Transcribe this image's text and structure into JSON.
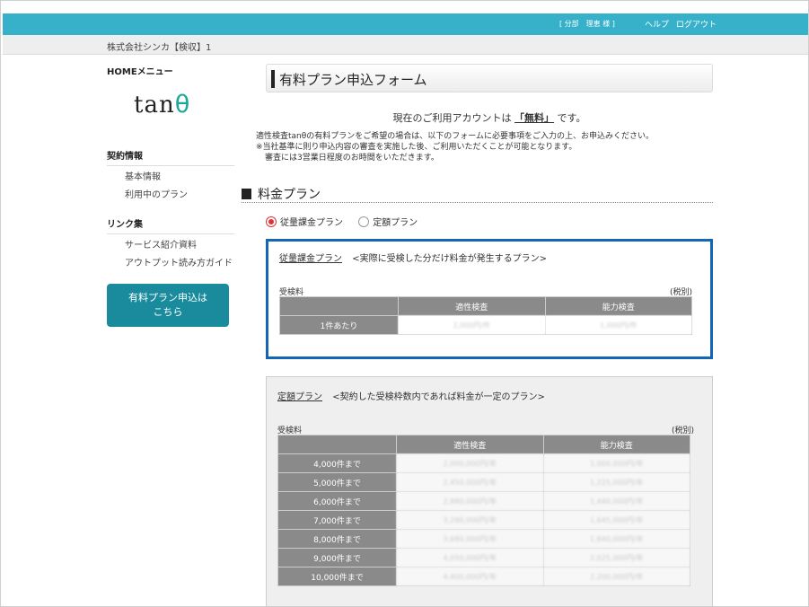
{
  "header": {
    "user_info": "[ 分部　理恵 様 ]",
    "help_label": "ヘルプ",
    "logout_label": "ログアウト",
    "company": "株式会社シンカ【検収】1"
  },
  "sidebar": {
    "home_title": "HOMEメニュー",
    "logo_text": "tan",
    "logo_symbol": "θ",
    "contract_title": "契約情報",
    "contract_items": [
      "基本情報",
      "利用中のプラン"
    ],
    "links_title": "リンク集",
    "link_items": [
      "サービス紹介資料",
      "アウトプット読み方ガイド"
    ],
    "apply_button": [
      "有料プラン申込は",
      "こちら"
    ]
  },
  "main": {
    "form_title": "有料プラン申込フォーム",
    "account_prefix": "現在のご利用アカウントは",
    "account_plan": "「無料」",
    "account_suffix": "です。",
    "desc_lines": [
      "適性検査tanθの有料プランをご希望の場合は、以下のフォームに必要事項をご入力の上、お申込みください。",
      "※当社基準に則り申込内容の審査を実施した後、ご利用いただくことが可能となります。",
      "審査には3営業日程度のお時間をいただきます。"
    ],
    "price_heading": "料金プラン",
    "radio_options": [
      {
        "label": "従量課金プラン",
        "selected": true
      },
      {
        "label": "定額プラン",
        "selected": false
      }
    ],
    "usage_plan": {
      "name": "従量課金プラン",
      "description": "<実際に受検した分だけ料金が発生するプラン>",
      "fee_label": "受検料",
      "tax_label": "(税別)",
      "columns": [
        "適性検査",
        "能力検査"
      ],
      "rows": [
        {
          "label": "1件あたり",
          "values": [
            "2,000円/件",
            "1,000円/件"
          ]
        }
      ]
    },
    "fixed_plan": {
      "name": "定額プラン",
      "description": "<契約した受検枠数内であれば料金が一定のプラン>",
      "fee_label": "受検料",
      "tax_label": "(税別)",
      "columns": [
        "適性検査",
        "能力検査"
      ],
      "rows": [
        {
          "label": "4,000件まで",
          "values": [
            "2,000,000円/年",
            "1,000,000円/年"
          ]
        },
        {
          "label": "5,000件まで",
          "values": [
            "2,450,000円/年",
            "1,225,000円/年"
          ]
        },
        {
          "label": "6,000件まで",
          "values": [
            "2,880,000円/年",
            "1,440,000円/年"
          ]
        },
        {
          "label": "7,000件まで",
          "values": [
            "3,290,000円/年",
            "1,645,000円/年"
          ]
        },
        {
          "label": "8,000件まで",
          "values": [
            "3,680,000円/年",
            "1,840,000円/年"
          ]
        },
        {
          "label": "9,000件まで",
          "values": [
            "4,050,000円/年",
            "2,025,000円/年"
          ]
        },
        {
          "label": "10,000件まで",
          "values": [
            "4,400,000円/年",
            "2,200,000円/年"
          ]
        }
      ]
    }
  },
  "colors": {
    "header_bg": "#36b1c9",
    "accent_teal": "#1a8b9c",
    "selected_border": "#1565b5",
    "radio_selected": "#dd3333",
    "table_header": "#8a8a8a"
  }
}
